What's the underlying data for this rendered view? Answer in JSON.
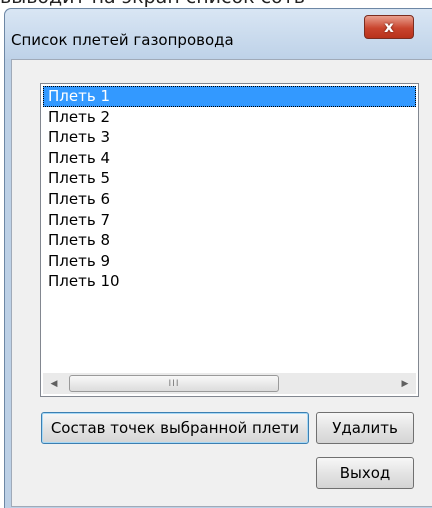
{
  "top_caption": "выводит на экран список сотв",
  "window": {
    "title": "Список плетей  газопровода",
    "close_label": "x"
  },
  "list": {
    "items": [
      {
        "label": "Плеть 1",
        "selected": true
      },
      {
        "label": "Плеть 2",
        "selected": false
      },
      {
        "label": "Плеть 3",
        "selected": false
      },
      {
        "label": "Плеть 4",
        "selected": false
      },
      {
        "label": "Плеть 5",
        "selected": false
      },
      {
        "label": "Плеть 6",
        "selected": false
      },
      {
        "label": "Плеть 7",
        "selected": false
      },
      {
        "label": "Плеть 8",
        "selected": false
      },
      {
        "label": "Плеть 9",
        "selected": false
      },
      {
        "label": "Плеть 10",
        "selected": false
      }
    ],
    "scrollbar": {
      "left_arrow": "◀",
      "right_arrow": "▶",
      "grip": "III"
    }
  },
  "buttons": {
    "points_label": "Состав точек выбранной плети",
    "delete_label": "Удалить",
    "exit_label": "Выход"
  },
  "colors": {
    "selection": "#3399ff",
    "close_button": "#c9452e",
    "frame": "#bcd0e6"
  }
}
